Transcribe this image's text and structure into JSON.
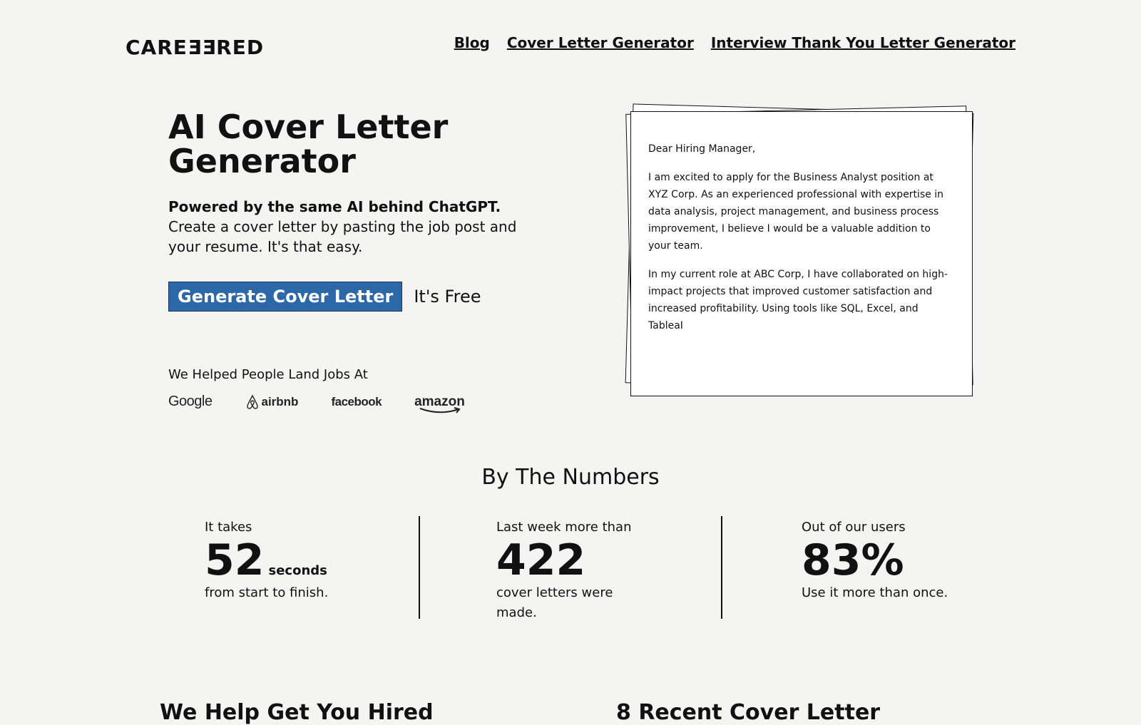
{
  "header": {
    "logo_prefix": "CARE",
    "logo_flipped": "EE",
    "logo_suffix": "RED",
    "nav": [
      "Blog",
      "Cover Letter Generator",
      "Interview Thank You Letter Generator"
    ]
  },
  "hero": {
    "title": "AI Cover Letter Generator",
    "tagline": "Powered by the same AI behind ChatGPT.",
    "description": "Create a cover letter by pasting the job post and your resume. It's that easy.",
    "cta_label": "Generate Cover Letter",
    "free_text": "It's Free",
    "helped_text": "We Helped People Land Jobs At",
    "logos": [
      "Google",
      "airbnb",
      "facebook",
      "amazon"
    ]
  },
  "letter": {
    "greeting": "Dear Hiring Manager,",
    "paragraph1": "I am excited to apply for the Business Analyst position at XYZ Corp. As an experienced professional with expertise in data analysis, project management, and business process improvement, I believe I would be a valuable addition to your team.",
    "paragraph2": "In my current role at ABC Corp, I have collaborated on high-impact projects that improved customer satisfaction and increased profitability. Using tools like SQL, Excel, and TableaI"
  },
  "numbers": {
    "title": "By The Numbers",
    "stats": [
      {
        "lead": "It takes",
        "value": "52",
        "unit": "seconds",
        "tail": "from start to finish."
      },
      {
        "lead": "Last week more than",
        "value": "422",
        "tail": "cover letters were made."
      },
      {
        "lead": "Out of our users",
        "value": "83%",
        "tail": "Use it more than once."
      }
    ]
  },
  "bottom": {
    "heading_left": "We Help Get You Hired",
    "heading_right": "8 Recent Cover Letter"
  },
  "colors": {
    "accent": "#2c67a8",
    "background": "#f4f4f2"
  }
}
